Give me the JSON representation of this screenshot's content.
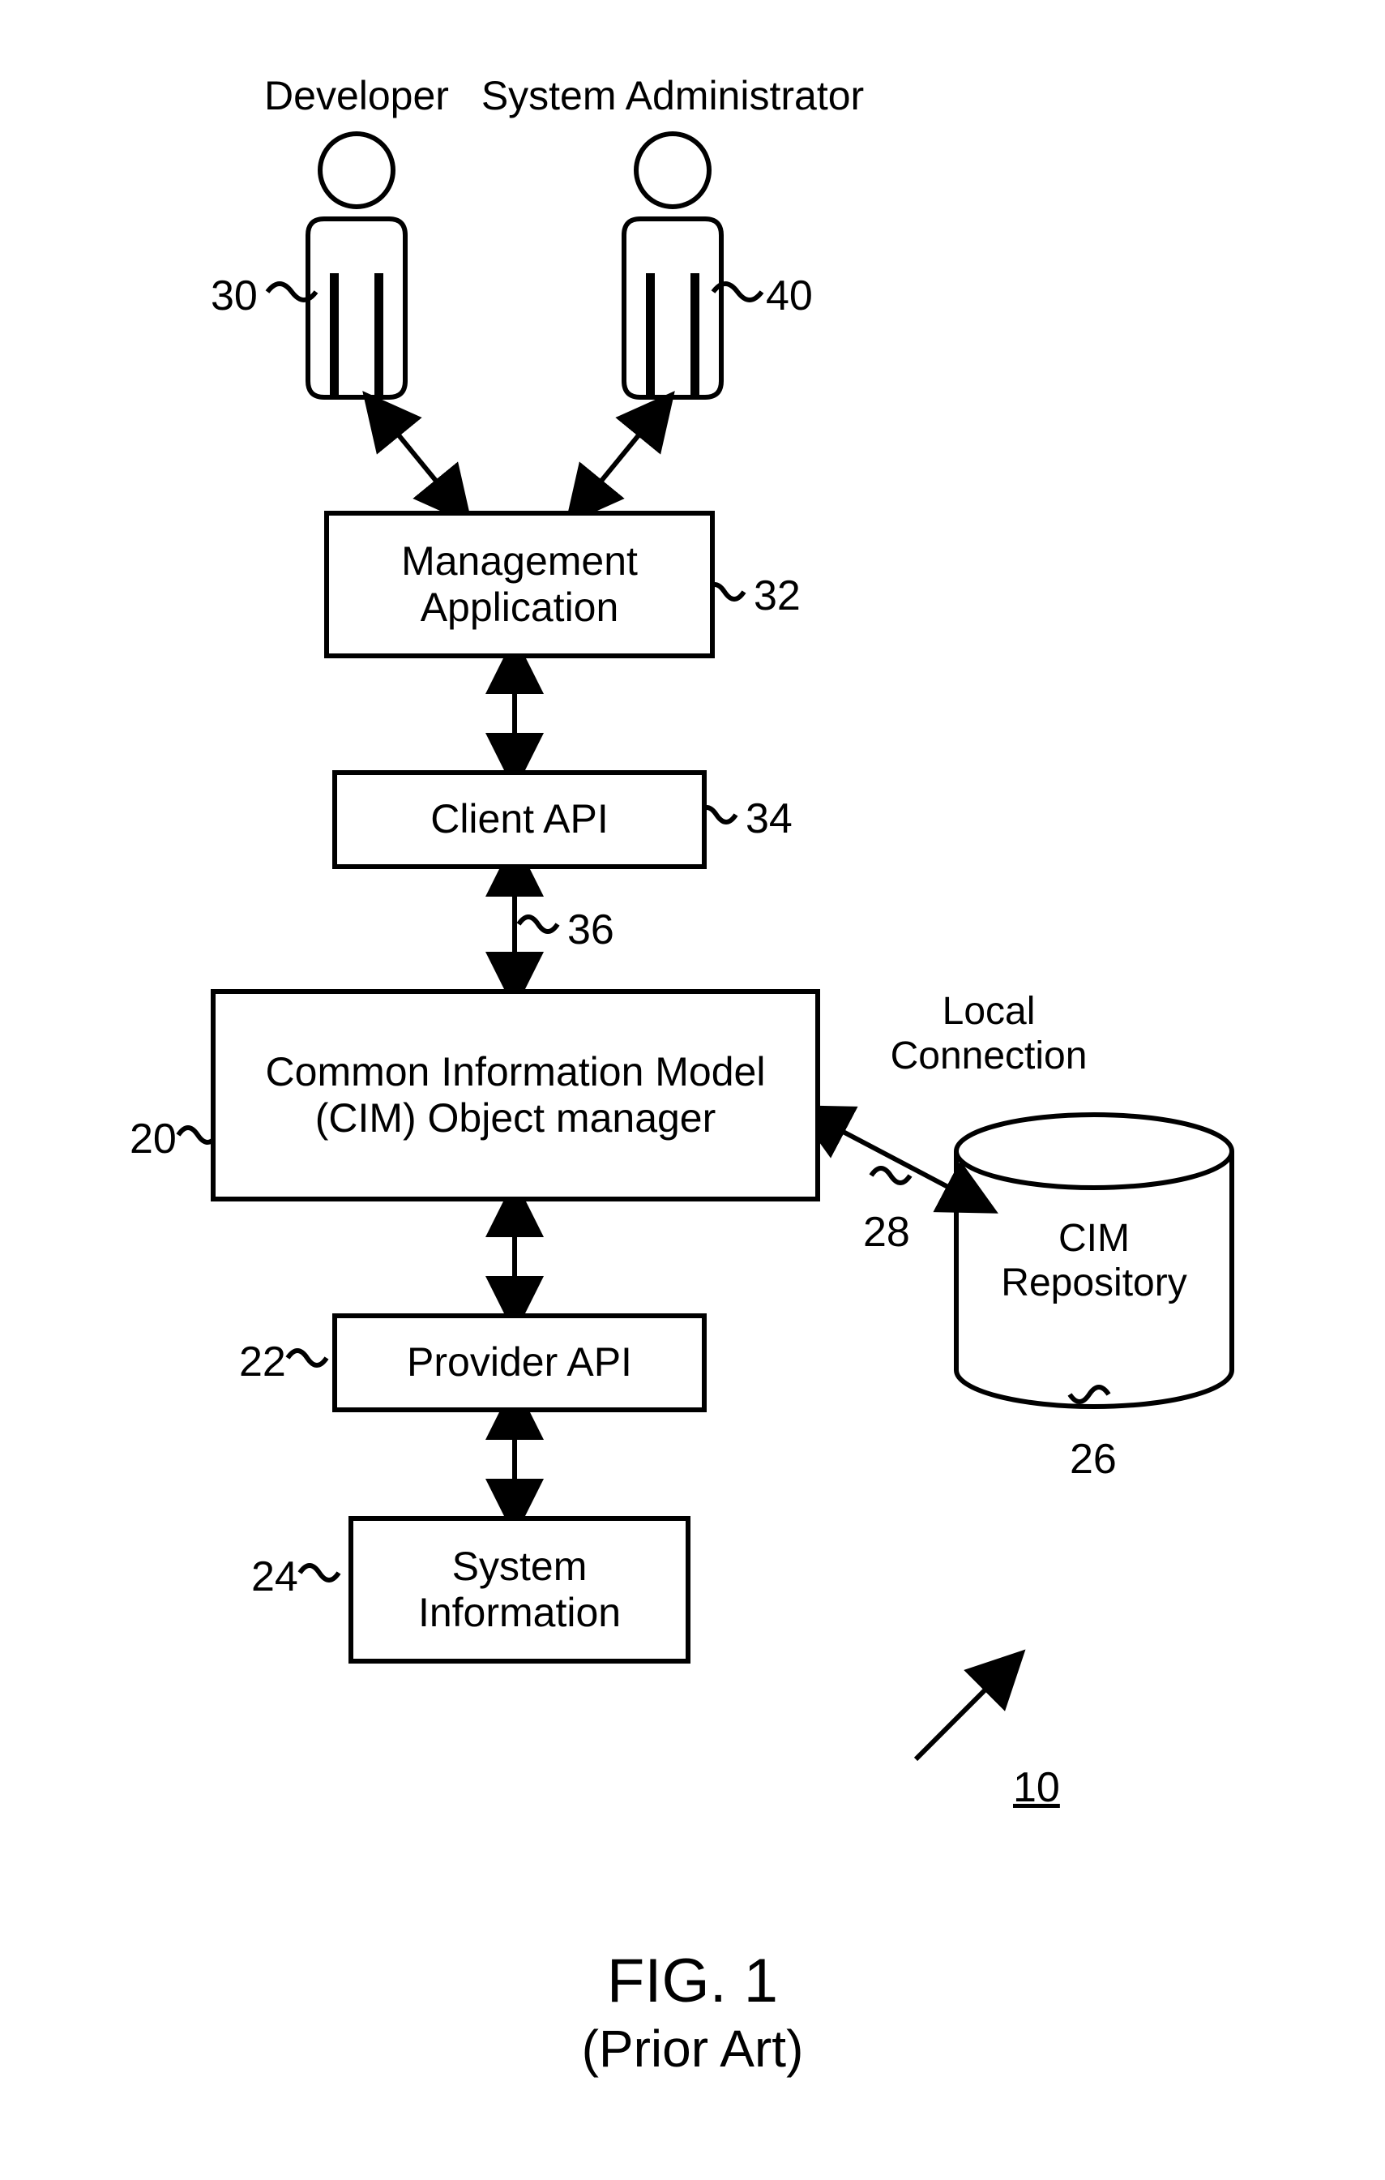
{
  "actors": {
    "developer": "Developer",
    "sysadmin": "System Administrator"
  },
  "boxes": {
    "management": "Management\nApplication",
    "clientapi": "Client API",
    "cim": "Common Information Model\n(CIM) Object manager",
    "providerapi": "Provider API",
    "sysinfo": "System\nInformation"
  },
  "cylinder": {
    "label": "CIM\nRepository"
  },
  "conn": {
    "local": "Local\nConnection"
  },
  "refs": {
    "r30": "30",
    "r40": "40",
    "r32": "32",
    "r34": "34",
    "r36": "36",
    "r20": "20",
    "r28": "28",
    "r22": "22",
    "r24": "24",
    "r26": "26",
    "r10": "10"
  },
  "figure": {
    "title": "FIG. 1",
    "subtitle": "(Prior Art)"
  }
}
